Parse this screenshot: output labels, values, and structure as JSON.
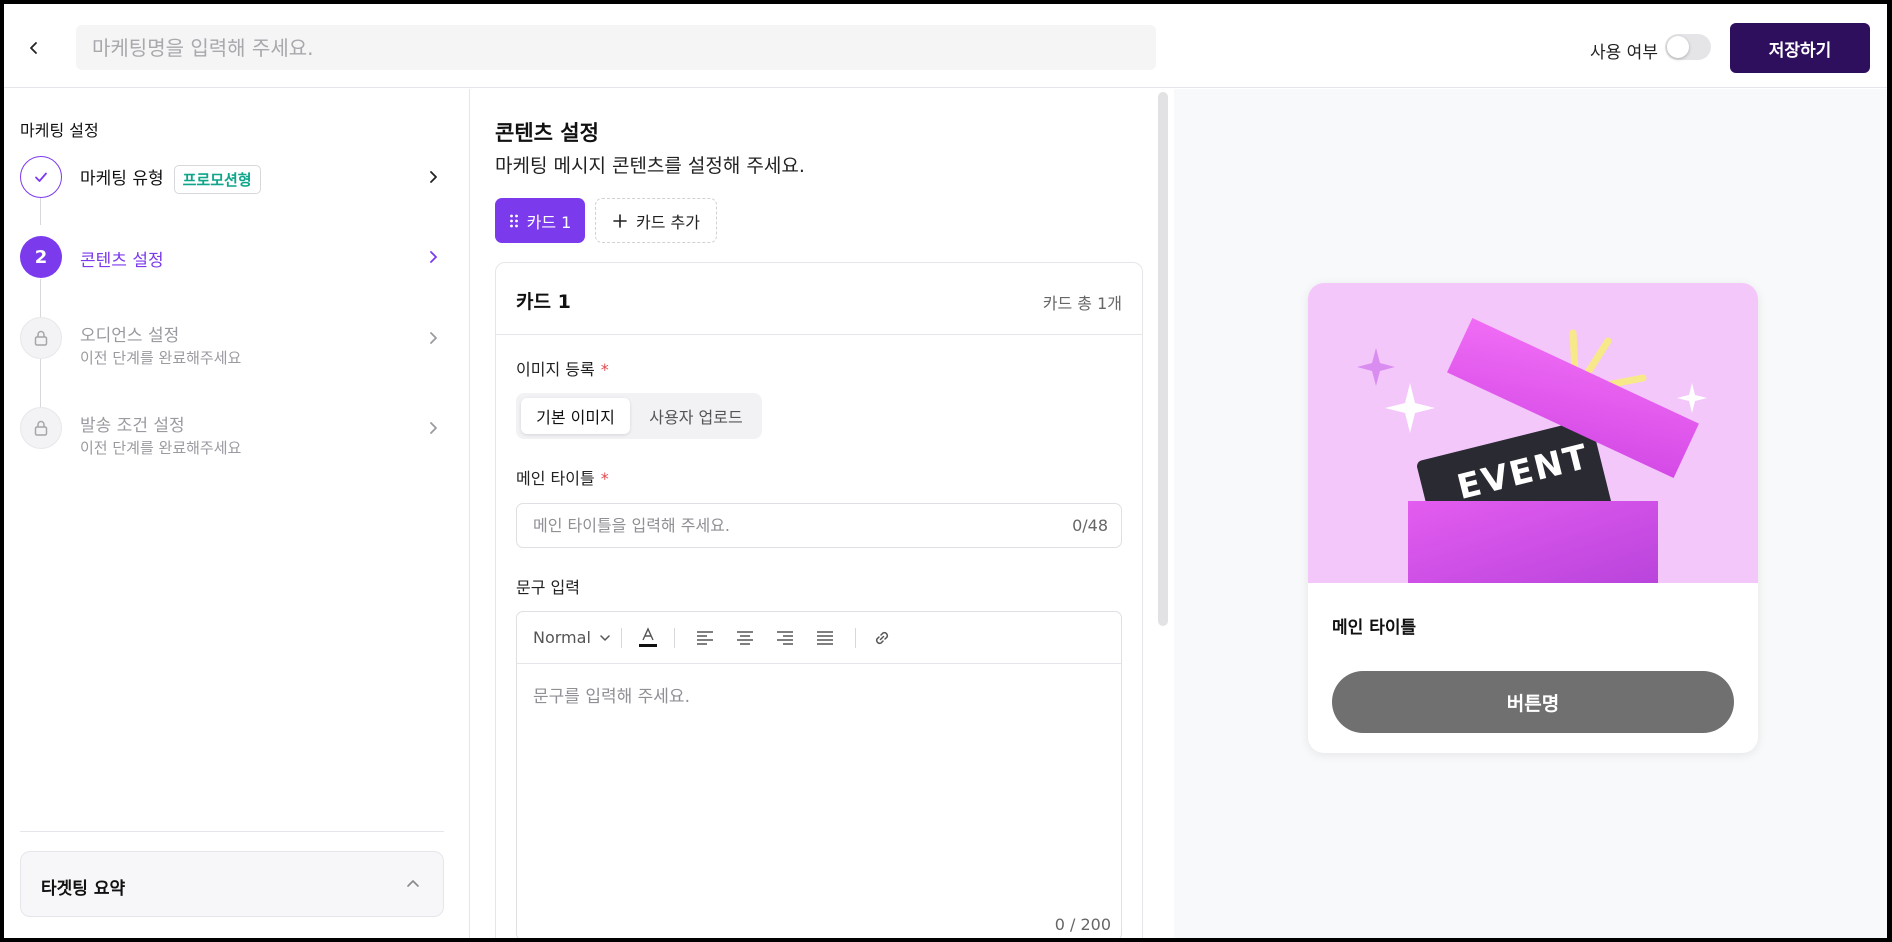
{
  "header": {
    "title_placeholder": "마케팅명을 입력해 주세요.",
    "use_label": "사용 여부",
    "save_label": "저장하기"
  },
  "sidebar": {
    "title": "마케팅 설정",
    "steps": [
      {
        "label": "마케팅 유형",
        "badge": "프로모션형",
        "state": "done"
      },
      {
        "number": "2",
        "label": "콘텐츠 설정",
        "state": "active"
      },
      {
        "label": "오디언스 설정",
        "sub": "이전 단계를 완료해주세요",
        "state": "locked"
      },
      {
        "label": "발송 조건 설정",
        "sub": "이전 단계를 완료해주세요",
        "state": "locked"
      }
    ],
    "summary_label": "타겟팅 요약"
  },
  "content": {
    "title": "콘텐츠 설정",
    "description": "마케팅 메시지 콘텐츠를 설정해 주세요.",
    "card_tab": "카드 1",
    "add_card": "카드 추가",
    "card": {
      "title": "카드 1",
      "count": "카드 총 1개",
      "image_label": "이미지 등록",
      "image_options": [
        "기본 이미지",
        "사용자 업로드"
      ],
      "main_title_label": "메인 타이틀",
      "main_title_placeholder": "메인 타이틀을 입력해 주세요.",
      "main_title_count": "0/48",
      "text_label": "문구 입력",
      "editor_format": "Normal",
      "editor_placeholder": "문구를 입력해 주세요.",
      "editor_count": "0 / 200"
    }
  },
  "preview": {
    "image_text": "EVENT",
    "title": "메인 타이틀",
    "button": "버튼명"
  },
  "colors": {
    "accent": "#7c3aed",
    "save_button": "#2e0f5e",
    "badge_text": "#0ea58a",
    "preview_button": "#707070"
  }
}
